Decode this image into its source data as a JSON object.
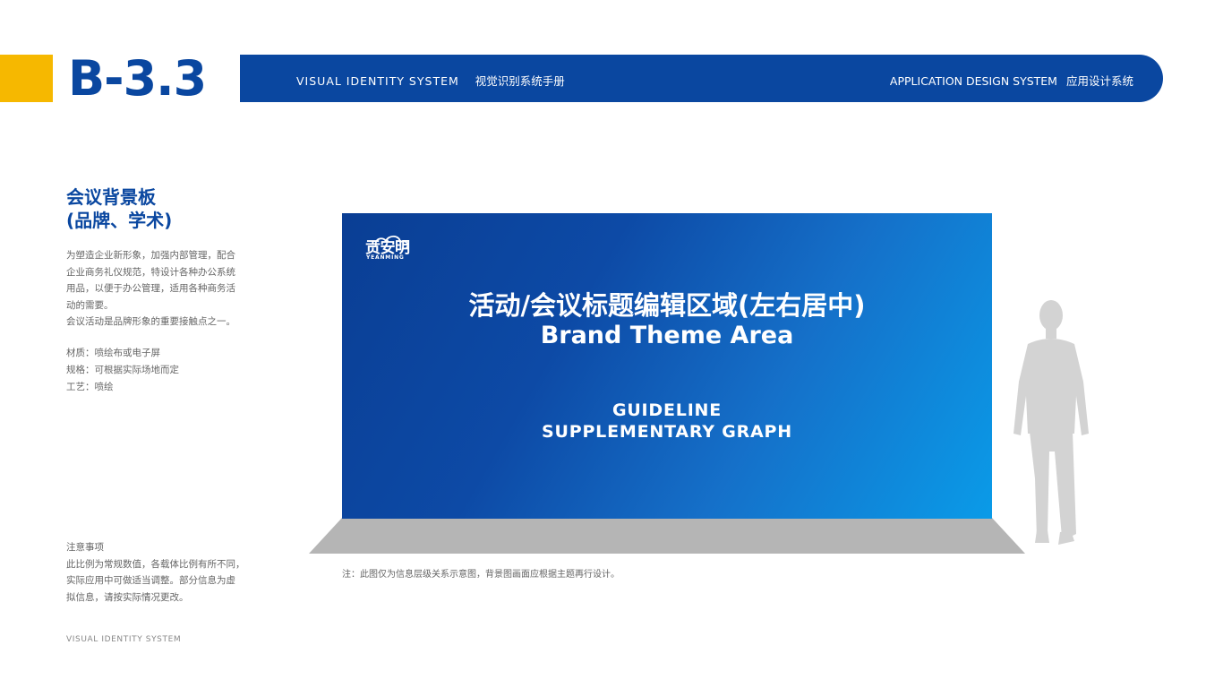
{
  "page_code": "B-3.3",
  "header": {
    "left_en": "VISUAL IDENTITY SYSTEM",
    "left_cn": "视觉识别系统手册",
    "right_en": "APPLICATION DESIGN SYSTEM",
    "right_cn": "应用设计系统"
  },
  "section": {
    "title_line1": "会议背景板",
    "title_line2": "(品牌、学术)",
    "description": [
      "为塑造企业新形象，加强内部管理，配合",
      "企业商务礼仪规范，特设计各种办公系统",
      "用品，以便于办公管理，适用各种商务活",
      "动的需要。",
      "会议活动是品牌形象的重要接触点之一。"
    ],
    "specs": [
      "材质：喷绘布或电子屏",
      "规格：可根据实际场地而定",
      "工艺：喷绘"
    ],
    "notice": [
      "注意事项",
      "此比例为常规数值，各载体比例有所不同，",
      "实际应用中可做适当调整。部分信息为虚",
      "拟信息，请按实际情况更改。"
    ]
  },
  "backdrop": {
    "logo_cn": "贡安明",
    "logo_en": "YEANMING",
    "title_cn": "活动/会议标题编辑区域(左右居中)",
    "title_en": "Brand Theme Area",
    "guide_line1": "GUIDELINE",
    "guide_line2": "SUPPLEMENTARY GRAPH"
  },
  "note": "注：此图仅为信息层级关系示意图，背景图画面应根据主题再行设计。",
  "footer": "VISUAL IDENTITY SYSTEM",
  "colors": {
    "brand_blue": "#0a47a0",
    "accent_yellow": "#f6b800",
    "gradient_light": "#0a9be8",
    "floor_gray": "#b5b5b5",
    "silhouette_gray": "#d3d3d3"
  }
}
